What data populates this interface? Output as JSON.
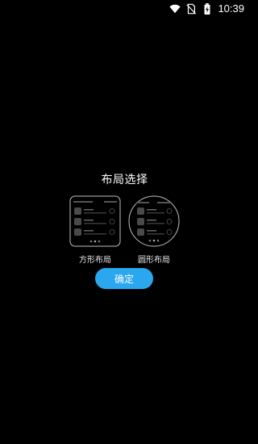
{
  "status_bar": {
    "time": "10:39",
    "icons": [
      "wifi-icon",
      "no-sim-icon",
      "battery-charging-icon"
    ]
  },
  "dialog": {
    "title": "布局选择",
    "options": [
      {
        "label": "方形布局",
        "icon": "square-layout-preview-icon"
      },
      {
        "label": "圆形布局",
        "icon": "round-layout-preview-icon"
      }
    ],
    "confirm_label": "确定"
  },
  "colors": {
    "background": "#000000",
    "accent": "#2aa7ef",
    "preview_outline": "#bfbfbf"
  }
}
